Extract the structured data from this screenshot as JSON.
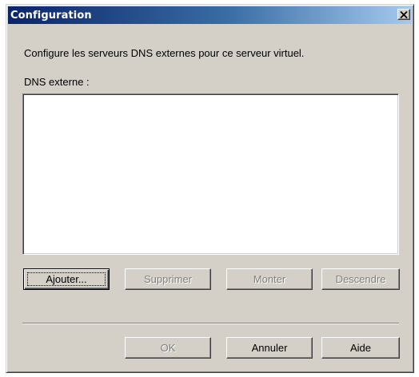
{
  "window": {
    "title": "Configuration",
    "close_icon": "close-x-icon"
  },
  "description": "Configure les serveurs DNS externes pour ce serveur virtuel.",
  "dns_list": {
    "label": "DNS externe :",
    "items": []
  },
  "list_buttons": {
    "add": "Ajouter...",
    "remove": "Supprimer",
    "move_up": "Monter",
    "move_down": "Descendre"
  },
  "footer_buttons": {
    "ok": "OK",
    "cancel": "Annuler",
    "help": "Aide"
  },
  "state": {
    "add_enabled": true,
    "remove_enabled": false,
    "move_up_enabled": false,
    "move_down_enabled": false,
    "ok_enabled": false,
    "cancel_enabled": true,
    "help_enabled": true,
    "focused_button": "add"
  },
  "colors": {
    "face": "#d4d0c8",
    "title_start": "#0a246a",
    "title_end": "#a6caf0",
    "disabled_text": "#808080"
  }
}
